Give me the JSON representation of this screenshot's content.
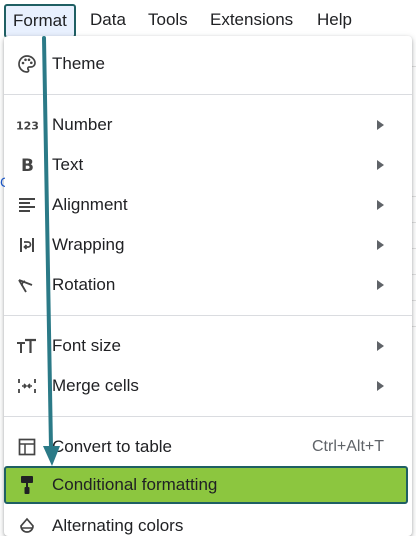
{
  "menubar": {
    "items": [
      {
        "label": "Format"
      },
      {
        "label": "Data"
      },
      {
        "label": "Tools"
      },
      {
        "label": "Extensions"
      },
      {
        "label": "Help"
      }
    ]
  },
  "menu": {
    "theme": {
      "label": "Theme",
      "icon": "palette-icon"
    },
    "number": {
      "label": "Number",
      "icon": "number-123-icon"
    },
    "text": {
      "label": "Text",
      "icon": "bold-icon"
    },
    "alignment": {
      "label": "Alignment",
      "icon": "align-left-icon"
    },
    "wrapping": {
      "label": "Wrapping",
      "icon": "wrap-icon"
    },
    "rotation": {
      "label": "Rotation",
      "icon": "rotation-icon"
    },
    "font_size": {
      "label": "Font size",
      "icon": "font-size-icon"
    },
    "merge_cells": {
      "label": "Merge cells",
      "icon": "merge-cells-icon"
    },
    "convert_to_table": {
      "label": "Convert to table",
      "shortcut": "Ctrl+Alt+T",
      "icon": "table-icon"
    },
    "conditional_formatting": {
      "label": "Conditional formatting",
      "icon": "paint-roller-icon"
    },
    "alternating_colors": {
      "label": "Alternating colors",
      "icon": "fill-drop-icon"
    }
  },
  "colors": {
    "highlight_fill": "#8cc63f",
    "highlight_border": "#1f5f63",
    "arrow": "#2b7a87"
  }
}
